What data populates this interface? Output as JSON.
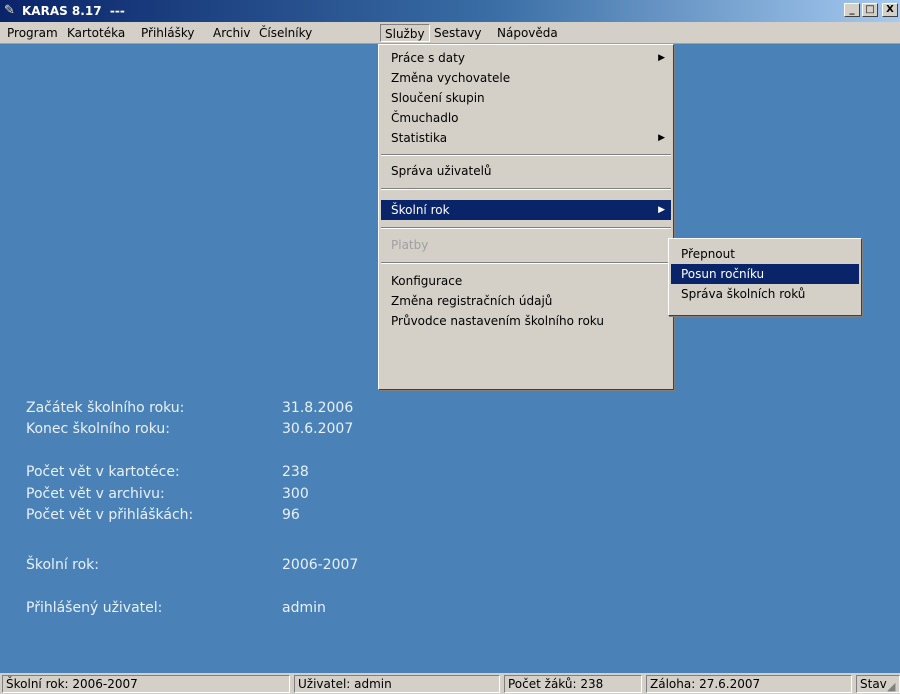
{
  "window": {
    "title": "KARAS 8.17  ---",
    "minimize": "_",
    "maximize": "□",
    "close": "X"
  },
  "menubar": {
    "items": [
      "Program",
      "Kartotéka",
      "Přihlášky",
      "Archiv",
      "Číselníky",
      "Služby",
      "Sestavy",
      "Nápověda"
    ],
    "open_item": "Služby"
  },
  "sluzby_menu": {
    "items": [
      {
        "label": "Práce s daty",
        "submenu": true
      },
      {
        "label": "Změna vychovatele"
      },
      {
        "label": "Sloučení skupin"
      },
      {
        "label": "Čmuchadlo"
      },
      {
        "label": "Statistika",
        "submenu": true
      },
      {
        "label": "Správa uživatelů"
      },
      {
        "label": "Školní rok",
        "submenu": true,
        "highlighted": true
      },
      {
        "label": "Platby",
        "disabled": true
      },
      {
        "label": "Konfigurace"
      },
      {
        "label": "Změna registračních údajů"
      },
      {
        "label": "Průvodce nastavením školního roku"
      }
    ],
    "arrow": "▶"
  },
  "skolni_rok_submenu": {
    "items": [
      {
        "label": "Přepnout"
      },
      {
        "label": "Posun ročníku",
        "highlighted": true
      },
      {
        "label": "Správa školních roků"
      }
    ]
  },
  "info": {
    "start_label": "Začátek školního roku:",
    "start_value": "31.8.2006",
    "end_label": "Konec školního roku:",
    "end_value": "30.6.2007",
    "kartoteka_label": "Počet vět v kartotéce:",
    "kartoteka_value": "238",
    "archiv_label": "Počet vět v archivu:",
    "archiv_value": "300",
    "prihlasky_label": "Počet vět v přihláškách:",
    "prihlasky_value": "96",
    "rok_label": "Školní rok:",
    "rok_value": "2006-2007",
    "user_label": "Přihlášený uživatel:",
    "user_value": "admin"
  },
  "statusbar": {
    "year": "Školní rok: 2006-2007",
    "user": "Uživatel: admin",
    "count": "Počet žáků: 238",
    "backup": "Záloha: 27.6.2007",
    "state": "Stav"
  },
  "colors": {
    "client_bg": "#4a82b8",
    "highlight": "#0a246a",
    "face": "#d4d0c8"
  }
}
